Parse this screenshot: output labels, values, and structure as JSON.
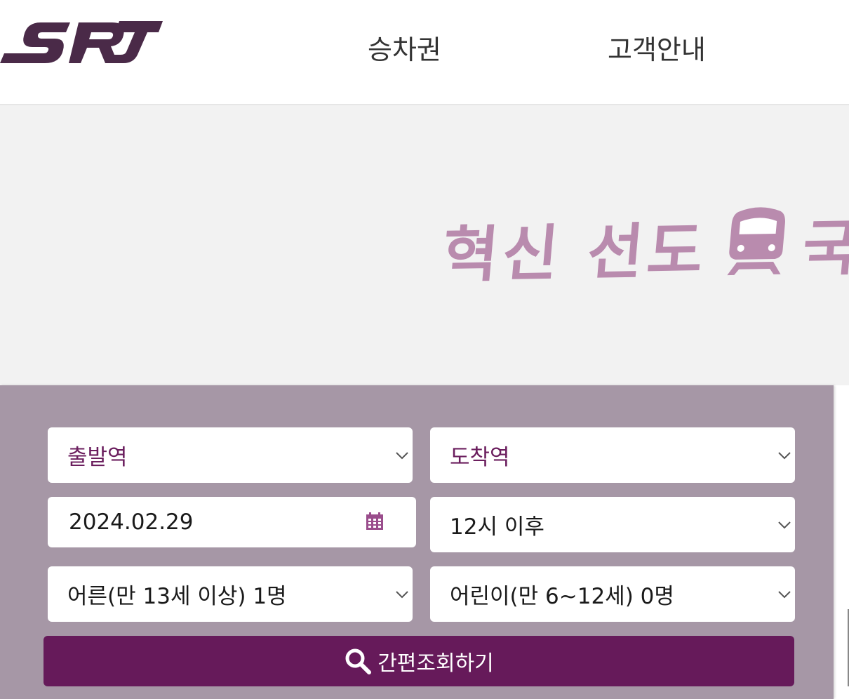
{
  "header": {
    "logo_text": "SRT",
    "nav": [
      "승차권",
      "고객안내"
    ]
  },
  "banner": {
    "slogan_part1": "혁신 선도",
    "slogan_part2": "국"
  },
  "search": {
    "departure_placeholder": "출발역",
    "arrival_placeholder": "도착역",
    "date_value": "2024.02.29",
    "time_value": "12시 이후",
    "adult_value": "어른(만 13세 이상) 1명",
    "child_value": "어린이(만 6~12세) 0명",
    "button_label": "간편조회하기"
  },
  "colors": {
    "brand": "#4a2a48",
    "accent": "#661a5a",
    "panel": "#a697a6",
    "slogan": "#b98bae"
  },
  "icons": [
    "chevron-down-icon",
    "calendar-icon",
    "search-icon",
    "train-icon"
  ]
}
